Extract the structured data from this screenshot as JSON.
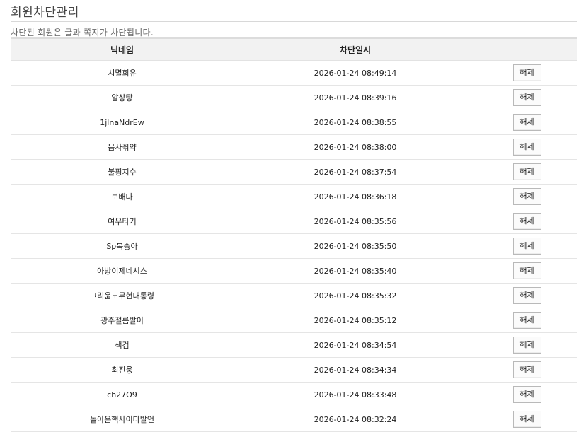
{
  "page": {
    "title": "회원차단관리",
    "notice": "차단된 회원은 글과 쪽지가 차단됩니다."
  },
  "table": {
    "headers": [
      "닉네임",
      "차단일시",
      ""
    ],
    "action_label": "해제",
    "rows": [
      {
        "nickname": "시멸회유",
        "blocked_at": "2026-01-24 08:49:14"
      },
      {
        "nickname": "알상탕",
        "blocked_at": "2026-01-24 08:39:16"
      },
      {
        "nickname": "1jlnaNdrEw",
        "blocked_at": "2026-01-24 08:38:55"
      },
      {
        "nickname": "음사쥒약",
        "blocked_at": "2026-01-24 08:38:00"
      },
      {
        "nickname": "불핑지수",
        "blocked_at": "2026-01-24 08:37:54"
      },
      {
        "nickname": "보배다",
        "blocked_at": "2026-01-24 08:36:18"
      },
      {
        "nickname": "여우타기",
        "blocked_at": "2026-01-24 08:35:56"
      },
      {
        "nickname": "Sp복숭아",
        "blocked_at": "2026-01-24 08:35:50"
      },
      {
        "nickname": "아방이제네시스",
        "blocked_at": "2026-01-24 08:35:40"
      },
      {
        "nickname": "그리윤노무현대통령",
        "blocked_at": "2026-01-24 08:35:32"
      },
      {
        "nickname": "광주절름발이",
        "blocked_at": "2026-01-24 08:35:12"
      },
      {
        "nickname": "색검",
        "blocked_at": "2026-01-24 08:34:54"
      },
      {
        "nickname": "최진웅",
        "blocked_at": "2026-01-24 08:34:34"
      },
      {
        "nickname": "ch27O9",
        "blocked_at": "2026-01-24 08:33:48"
      },
      {
        "nickname": "돌아온핵사이다발언",
        "blocked_at": "2026-01-24 08:32:24"
      }
    ]
  }
}
